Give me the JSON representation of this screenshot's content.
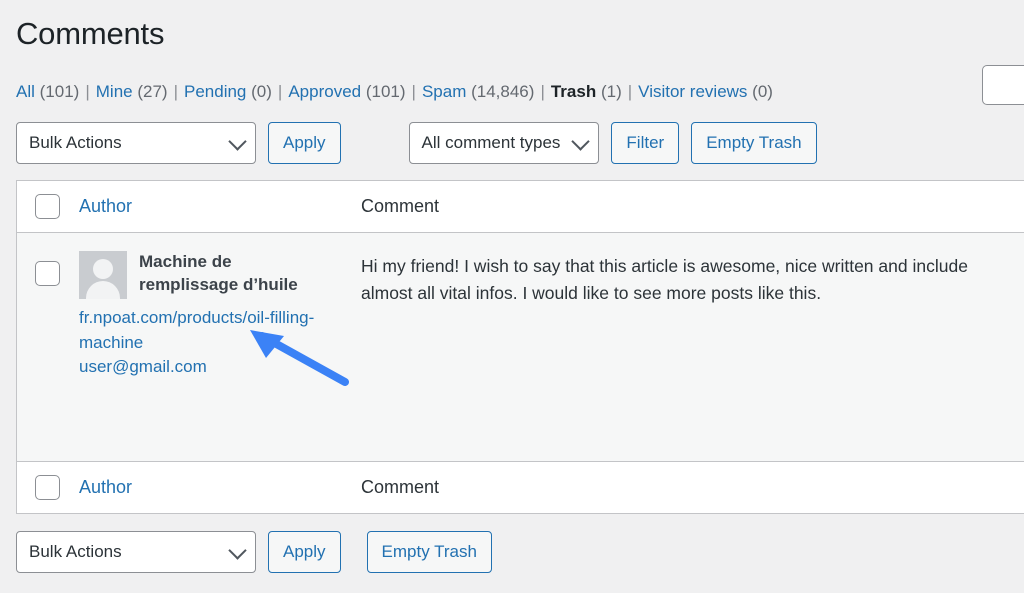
{
  "page": {
    "title": "Comments"
  },
  "filters": {
    "separator": "|",
    "items": [
      {
        "label": "All",
        "count": "(101)",
        "current": false
      },
      {
        "label": "Mine",
        "count": "(27)",
        "current": false
      },
      {
        "label": "Pending",
        "count": "(0)",
        "current": false
      },
      {
        "label": "Approved",
        "count": "(101)",
        "current": false
      },
      {
        "label": "Spam",
        "count": "(14,846)",
        "current": false
      },
      {
        "label": "Trash",
        "count": "(1)",
        "current": true
      },
      {
        "label": "Visitor reviews",
        "count": "(0)",
        "current": false
      }
    ]
  },
  "search": {
    "value": "",
    "placeholder": ""
  },
  "toolbar_top": {
    "bulk_actions_label": "Bulk Actions",
    "apply_label": "Apply",
    "comment_types_label": "All comment types",
    "filter_label": "Filter",
    "empty_trash_label": "Empty Trash",
    "chevron_icon": "chevron-down-icon"
  },
  "toolbar_bottom": {
    "bulk_actions_label": "Bulk Actions",
    "apply_label": "Apply",
    "empty_trash_label": "Empty Trash",
    "chevron_icon": "chevron-down-icon"
  },
  "table": {
    "columns": {
      "author": "Author",
      "comment": "Comment"
    },
    "rows": [
      {
        "author_name": "Machine de remplissage d’huile",
        "author_url": "fr.npoat.com/products/oil-filling-machine",
        "author_email": "user@gmail.com",
        "avatar_icon": "default-avatar-icon",
        "comment_text": "Hi my friend! I wish to say that this article is awesome, nice written and include almost all vital infos. I would like to see more posts like this."
      }
    ]
  },
  "annotation": {
    "arrow_icon": "arrow-up-left-icon",
    "color": "#3b82f6"
  },
  "colors": {
    "link": "#2271b1",
    "text": "#2c3338",
    "muted": "#646970",
    "page_bg": "#f0f0f1",
    "row_bg": "#f6f7f7",
    "border": "#c3c4c7"
  }
}
